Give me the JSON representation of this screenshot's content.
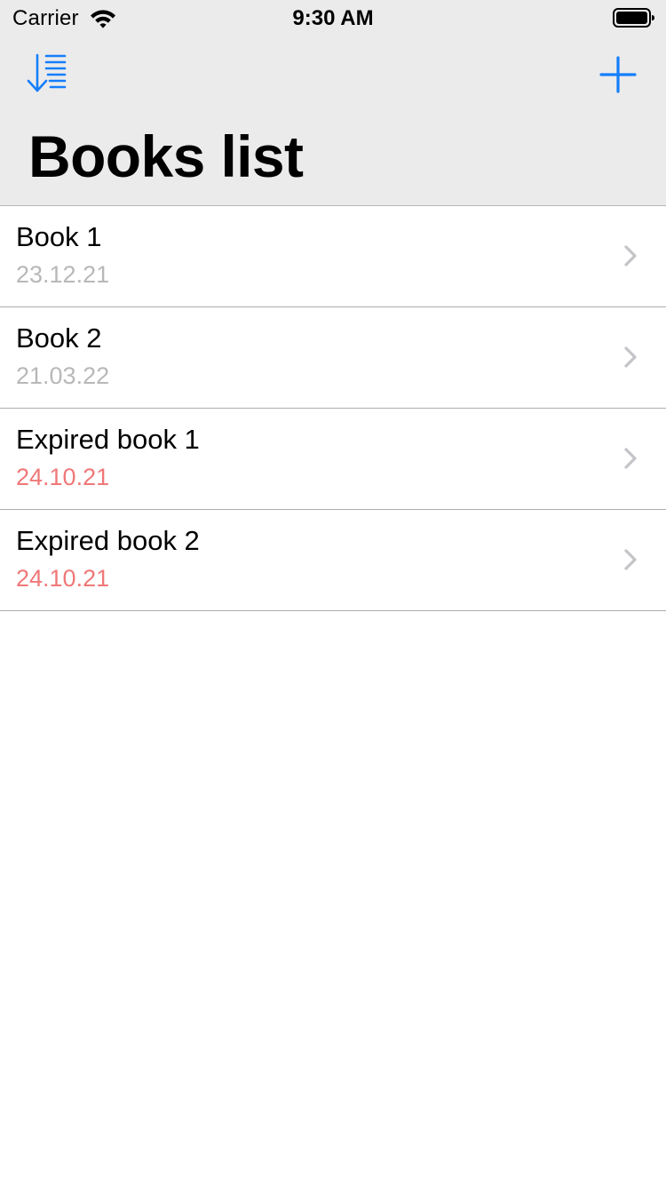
{
  "colors": {
    "accent": "#157efb",
    "bar_background": "#ebebeb",
    "regular_date": "#b8b8b8",
    "expired_date": "#f07878",
    "chevron": "#c4c4c9",
    "separator": "#adadad"
  },
  "status_bar": {
    "carrier": "Carrier",
    "time": "9:30 AM",
    "wifi_icon": "wifi-icon",
    "battery_icon": "battery-full-icon"
  },
  "nav": {
    "sort_icon": "sort-descending-icon",
    "add_icon": "plus-icon",
    "title": "Books list"
  },
  "books": [
    {
      "title": "Book 1",
      "date": "23.12.21",
      "expired": false
    },
    {
      "title": "Book 2",
      "date": "21.03.22",
      "expired": false
    },
    {
      "title": "Expired book 1",
      "date": "24.10.21",
      "expired": true
    },
    {
      "title": "Expired book 2",
      "date": "24.10.21",
      "expired": true
    }
  ]
}
